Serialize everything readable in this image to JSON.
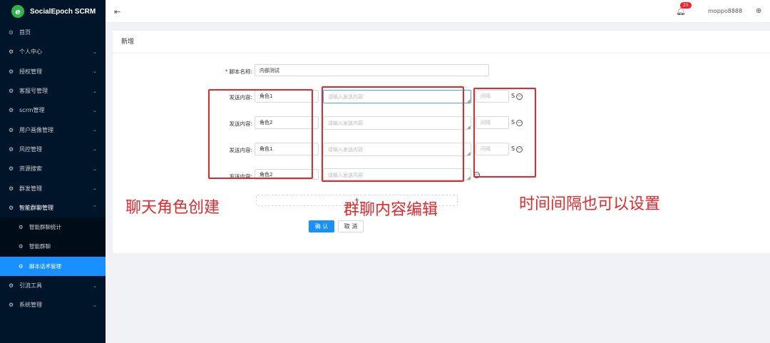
{
  "app": {
    "title": "SocialEpoch SCRM",
    "logo_letter": "e"
  },
  "sidebar": {
    "items": [
      {
        "label": "首页",
        "icon": "home-icon"
      },
      {
        "label": "个人中心",
        "icon": "gear-icon"
      },
      {
        "label": "授权管理",
        "icon": "gear-icon"
      },
      {
        "label": "客服号管理",
        "icon": "gear-icon"
      },
      {
        "label": "scrm管理",
        "icon": "gear-icon"
      },
      {
        "label": "用户画像管理",
        "icon": "gear-icon"
      },
      {
        "label": "风控管理",
        "icon": "gear-icon"
      },
      {
        "label": "资源搜索",
        "icon": "gear-icon"
      },
      {
        "label": "群发管理",
        "icon": "gear-icon"
      },
      {
        "label": "智能群聊管理",
        "icon": "gear-icon"
      }
    ],
    "sub_items": [
      {
        "label": "智能群聊统计"
      },
      {
        "label": "智能群聊"
      },
      {
        "label": "脚本话术管理"
      }
    ],
    "bottom_items": [
      {
        "label": "引流工具"
      },
      {
        "label": "系统管理"
      }
    ]
  },
  "header": {
    "notification_count": "25",
    "username": "moppo8888"
  },
  "form": {
    "card_title": "新增",
    "script_name_label": "脚本名称:",
    "script_name_value": "内部测试",
    "send_content_label": "发送内容:",
    "content_placeholder": "请输入发送内容",
    "interval_placeholder": "间隔",
    "unit": "S",
    "rows": [
      {
        "role": "角色1"
      },
      {
        "role": "角色2"
      },
      {
        "role": "角色1"
      },
      {
        "role": "角色2"
      }
    ],
    "add_label": "+",
    "confirm_label": "确 认",
    "cancel_label": "取 消"
  },
  "annotations": {
    "roles": "聊天角色创建",
    "content": "群聊内容编辑",
    "interval": "时间间隔也可以设置"
  },
  "colors": {
    "sidebar_bg": "#001529",
    "primary": "#1890ff",
    "annotation": "#e8272b"
  }
}
